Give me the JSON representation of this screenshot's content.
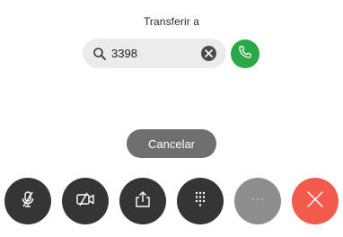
{
  "title": "Transferir a",
  "search": {
    "value": "3398",
    "icon": "search-icon",
    "clear_icon": "clear-icon"
  },
  "call": {
    "icon": "phone-icon",
    "color": "#2aa846"
  },
  "cancel_label": "Cancelar",
  "controls": [
    {
      "name": "mute",
      "icon": "microphone-muted-icon",
      "color": "#353535"
    },
    {
      "name": "video",
      "icon": "camera-off-icon",
      "color": "#353535"
    },
    {
      "name": "share",
      "icon": "share-icon",
      "color": "#353535"
    },
    {
      "name": "keypad",
      "icon": "keypad-icon",
      "color": "#353535"
    },
    {
      "name": "more",
      "icon": "more-icon",
      "color": "#8e8e8e"
    },
    {
      "name": "end-call",
      "icon": "close-icon",
      "color": "#f25b4c"
    }
  ]
}
